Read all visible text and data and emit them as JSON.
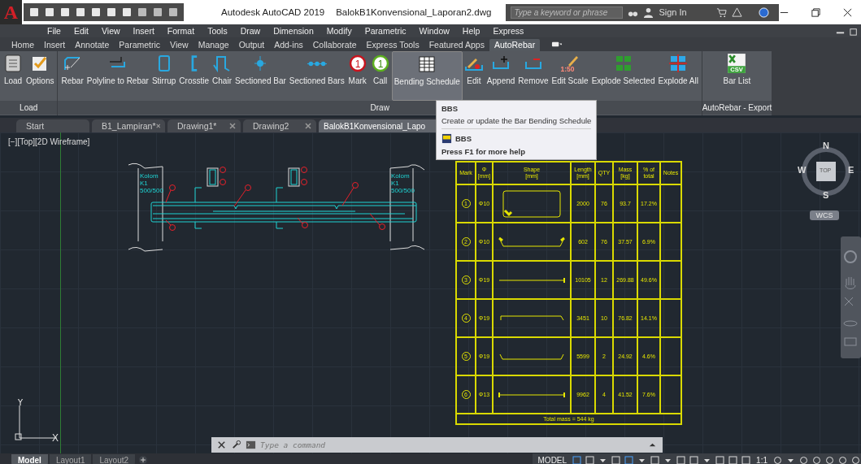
{
  "title_bar": {
    "app_letter": "A",
    "title": "Autodesk AutoCAD 2019",
    "file": "BalokB1Konvensional_Laporan2.dwg",
    "search_placeholder": "Type a keyword or phrase",
    "sign_in": "Sign In"
  },
  "menu_bar": [
    "File",
    "Edit",
    "View",
    "Insert",
    "Format",
    "Tools",
    "Draw",
    "Dimension",
    "Modify",
    "Parametric",
    "Window",
    "Help",
    "Express"
  ],
  "ribbon_tabs": [
    {
      "label": "Home",
      "selected": false
    },
    {
      "label": "Insert",
      "selected": false
    },
    {
      "label": "Annotate",
      "selected": false
    },
    {
      "label": "Parametric",
      "selected": false
    },
    {
      "label": "View",
      "selected": false
    },
    {
      "label": "Manage",
      "selected": false
    },
    {
      "label": "Output",
      "selected": false
    },
    {
      "label": "Add-ins",
      "selected": false
    },
    {
      "label": "Collaborate",
      "selected": false
    },
    {
      "label": "Express Tools",
      "selected": false
    },
    {
      "label": "Featured Apps",
      "selected": false
    },
    {
      "label": "AutoRebar",
      "selected": true
    }
  ],
  "ribbon_panels": [
    {
      "title": "Load",
      "tools": [
        {
          "label": "Load",
          "kind": "load",
          "selected": false
        },
        {
          "label": "Options",
          "kind": "options",
          "selected": false
        }
      ]
    },
    {
      "title": "Draw",
      "tools": [
        {
          "label": "Rebar",
          "kind": "rebar",
          "selected": false
        },
        {
          "label": "Polyline to Rebar",
          "kind": "polyline",
          "selected": false
        },
        {
          "label": "Stirrup",
          "kind": "stirrup",
          "selected": false
        },
        {
          "label": "Crosstie",
          "kind": "crosstie",
          "selected": false
        },
        {
          "label": "Chair",
          "kind": "chair",
          "selected": false
        },
        {
          "label": "Sectioned Bar",
          "kind": "section",
          "selected": false
        },
        {
          "label": "Sectioned Bars",
          "kind": "sections",
          "selected": false
        },
        {
          "label": "Mark",
          "kind": "mark",
          "icon_text": "1",
          "selected": false
        },
        {
          "label": "Call",
          "kind": "call",
          "icon_text": "1",
          "selected": false
        },
        {
          "label": "Bending Schedule",
          "kind": "schedule",
          "selected": true
        },
        {
          "label": "Edit",
          "kind": "edit",
          "selected": false
        },
        {
          "label": "Append",
          "kind": "append",
          "selected": false
        },
        {
          "label": "Remove",
          "kind": "remove",
          "selected": false
        },
        {
          "label": "Edit Scale",
          "kind": "scale",
          "icon_text": "1:50",
          "selected": false
        },
        {
          "label": "Explode Selected",
          "kind": "explode",
          "selected": false
        },
        {
          "label": "Explode All",
          "kind": "explodeall",
          "selected": false
        }
      ]
    },
    {
      "title": "AutoRebar - Export",
      "tools": [
        {
          "label": "Bar List",
          "kind": "csv",
          "icon_text": "CSV",
          "selected": false
        }
      ]
    }
  ],
  "tooltip": {
    "title": "BBS",
    "description": "Create or update the Bar Bending Schedule",
    "command": "BBS",
    "help": "Press F1 for more help"
  },
  "doc_tabs": [
    {
      "label": "Start",
      "selected": false,
      "closable": false
    },
    {
      "label": "B1_Lampiran*",
      "selected": false,
      "closable": true
    },
    {
      "label": "Drawing1*",
      "selected": false,
      "closable": true
    },
    {
      "label": "Drawing2",
      "selected": false,
      "closable": true
    },
    {
      "label": "BalokB1Konvensional_Lapo",
      "selected": true,
      "closable": false
    }
  ],
  "viewport_label": "[−][Top][2D Wireframe]",
  "beam_drawing": {
    "left_column_labels": [
      "Kolom",
      "K1",
      "500/500"
    ],
    "right_column_labels": [
      "Kolom",
      "K1",
      "500/500"
    ]
  },
  "schedule": {
    "columns": [
      "Mark",
      "Φ\n[mm]",
      "Shape\n[mm]",
      "Length\n[mm]",
      "QTY",
      "Mass\n[kg]",
      "% of\ntotal",
      "Notes"
    ],
    "rows": [
      {
        "mark": "1",
        "dia": "Φ10",
        "length": "2000",
        "qty": "76",
        "mass": "93.7",
        "percent": "17.2%"
      },
      {
        "mark": "2",
        "dia": "Φ10",
        "length": "602",
        "qty": "76",
        "mass": "37.57",
        "percent": "6.9%"
      },
      {
        "mark": "3",
        "dia": "Φ19",
        "length": "10105",
        "qty": "12",
        "mass": "269.88",
        "percent": "49.6%"
      },
      {
        "mark": "4",
        "dia": "Φ19",
        "length": "3451",
        "qty": "10",
        "mass": "76.82",
        "percent": "14.1%"
      },
      {
        "mark": "5",
        "dia": "Φ19",
        "length": "5599",
        "qty": "2",
        "mass": "24.92",
        "percent": "4.6%"
      },
      {
        "mark": "6",
        "dia": "Φ13",
        "length": "9962",
        "qty": "4",
        "mass": "41.52",
        "percent": "7.6%"
      }
    ],
    "total": "Total mass = 544 kg"
  },
  "viewcube": {
    "north": "N",
    "south": "S",
    "east": "E",
    "west": "W",
    "face": "TOP",
    "ucs": "WCS"
  },
  "ucs_icon": {
    "x": "X",
    "y": "Y"
  },
  "command_line": {
    "placeholder": "Type a command"
  },
  "layout_tabs": [
    {
      "label": "Model",
      "selected": true
    },
    {
      "label": "Layout1",
      "selected": false
    },
    {
      "label": "Layout2",
      "selected": false
    }
  ],
  "status_bar": {
    "model": "MODEL",
    "scale": "1:1"
  }
}
